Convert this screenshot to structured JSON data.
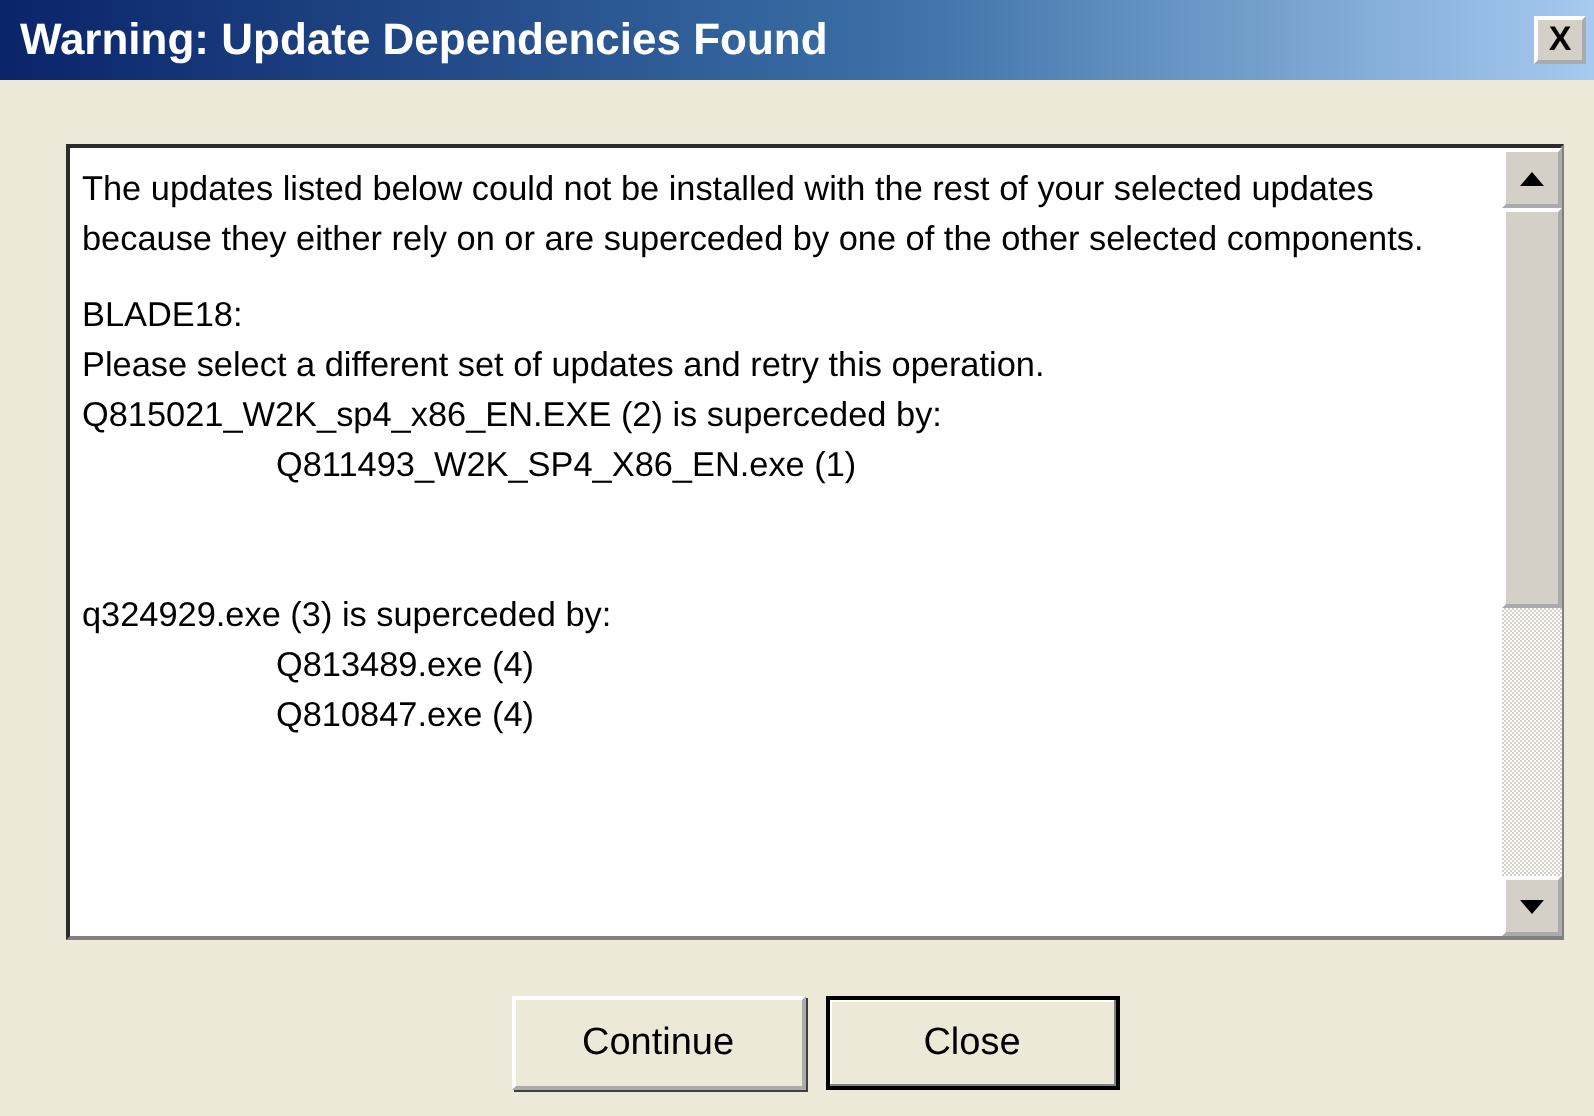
{
  "window": {
    "title": "Warning: Update Dependencies Found",
    "close": "X"
  },
  "message": {
    "sections": [
      {
        "lines": [
          {
            "kind": "paragraph",
            "text": "The updates listed below could not be installed with the rest of your selected updates because they either rely on or are superceded by one of the other selected components."
          }
        ]
      },
      {
        "lines": [
          {
            "kind": "text",
            "text": "BLADE18:"
          },
          {
            "kind": "text",
            "text": "Please select a different set of updates and retry this operation."
          },
          {
            "kind": "text",
            "text": "Q815021_W2K_sp4_x86_EN.EXE (2) is superceded by:"
          },
          {
            "kind": "indented",
            "text": "Q811493_W2K_SP4_X86_EN.exe (1)"
          }
        ]
      },
      {
        "lines": [
          {
            "kind": "text",
            "text": "q324929.exe (3) is superceded by:"
          },
          {
            "kind": "indented",
            "text": "Q813489.exe (4)"
          },
          {
            "kind": "indented",
            "text": "Q810847.exe (4)"
          }
        ]
      }
    ]
  },
  "buttons": [
    {
      "label": "Continue",
      "focused": false
    },
    {
      "label": "Close",
      "focused": true
    }
  ]
}
